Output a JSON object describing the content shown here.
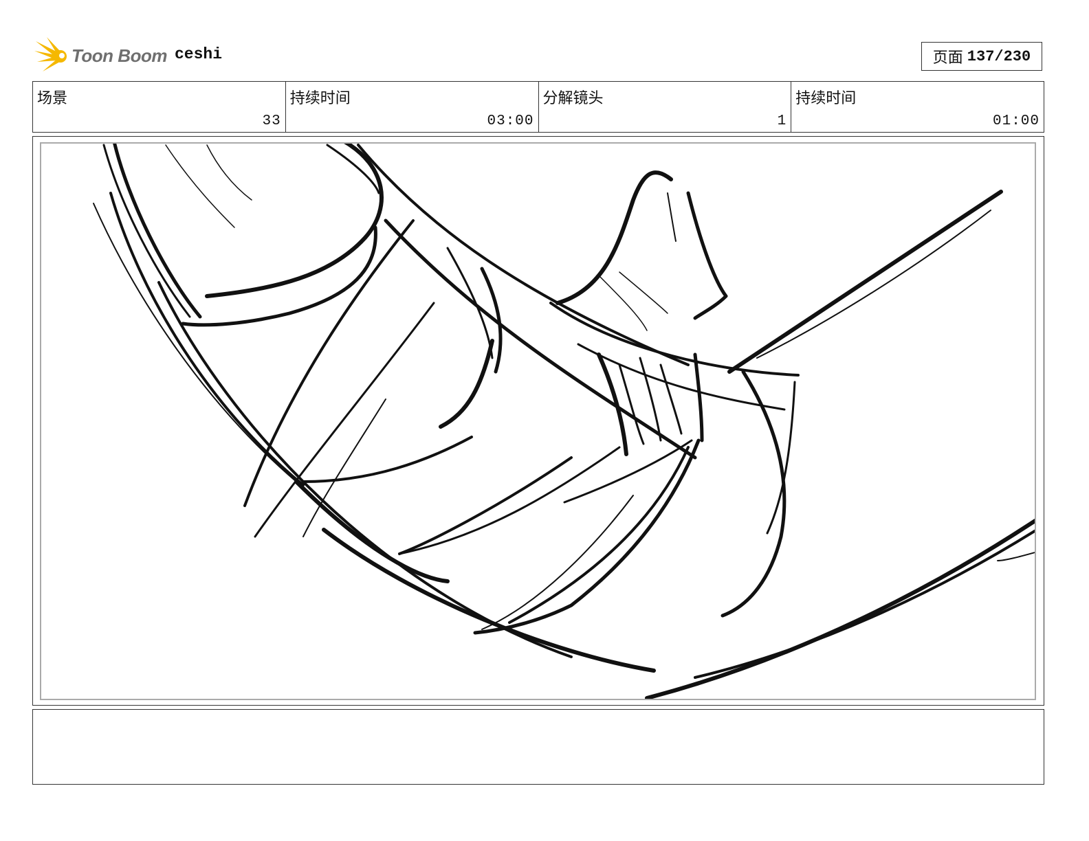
{
  "header": {
    "brand": "Toon Boom",
    "project_name": "ceshi",
    "page_label": "页面",
    "page_value": "137/230"
  },
  "info": {
    "scene_label": "场景",
    "scene_value": "33",
    "scene_duration_label": "持续时间",
    "scene_duration_value": "03:00",
    "panel_label": "分解镜头",
    "panel_value": "1",
    "panel_duration_label": "持续时间",
    "panel_duration_value": "01:00"
  },
  "colors": {
    "logo_star": "#f5b800",
    "stroke": "#111111"
  },
  "icons": {
    "logo": "toon-boom-star-icon"
  }
}
